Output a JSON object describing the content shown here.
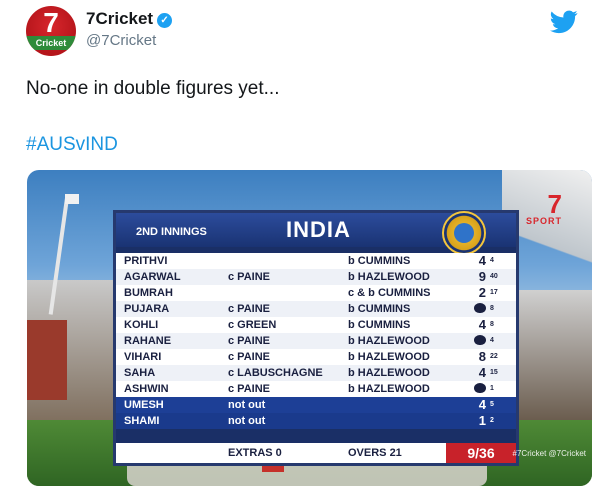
{
  "tweet": {
    "display_name": "7Cricket",
    "handle": "@7Cricket",
    "avatar_text": "7",
    "avatar_sub": "Cricket",
    "verified_icon": "verified-icon",
    "brand_icon": "twitter-bird-icon",
    "text": "No-one in double figures yet...",
    "hashtag": "#AUSvIND",
    "colors": {
      "link": "#1b95e0",
      "brand": "#1da1f2"
    }
  },
  "scorecard": {
    "innings": "2ND INNINGS",
    "team": "INDIA",
    "sport_logo": {
      "seven": "7",
      "word": "SPORT"
    },
    "batting": [
      {
        "name": "PRITHVI",
        "fielder": "",
        "bowler": "b CUMMINS",
        "runs": "4",
        "balls": "4",
        "duck": false
      },
      {
        "name": "AGARWAL",
        "fielder": "c PAINE",
        "bowler": "b HAZLEWOOD",
        "runs": "9",
        "balls": "40",
        "duck": false
      },
      {
        "name": "BUMRAH",
        "fielder": "",
        "bowler": "c & b CUMMINS",
        "runs": "2",
        "balls": "17",
        "duck": false
      },
      {
        "name": "PUJARA",
        "fielder": "c PAINE",
        "bowler": "b CUMMINS",
        "runs": "",
        "balls": "8",
        "duck": true
      },
      {
        "name": "KOHLI",
        "fielder": "c GREEN",
        "bowler": "b CUMMINS",
        "runs": "4",
        "balls": "8",
        "duck": false
      },
      {
        "name": "RAHANE",
        "fielder": "c PAINE",
        "bowler": "b HAZLEWOOD",
        "runs": "",
        "balls": "4",
        "duck": true
      },
      {
        "name": "VIHARI",
        "fielder": "c PAINE",
        "bowler": "b HAZLEWOOD",
        "runs": "8",
        "balls": "22",
        "duck": false
      },
      {
        "name": "SAHA",
        "fielder": "c LABUSCHAGNE",
        "bowler": "b HAZLEWOOD",
        "runs": "4",
        "balls": "15",
        "duck": false
      },
      {
        "name": "ASHWIN",
        "fielder": "c PAINE",
        "bowler": "b HAZLEWOOD",
        "runs": "",
        "balls": "1",
        "duck": true
      },
      {
        "name": "UMESH",
        "fielder": "not out",
        "bowler": "",
        "runs": "4",
        "balls": "5",
        "duck": false,
        "not_out": true
      },
      {
        "name": "SHAMI",
        "fielder": "not out",
        "bowler": "",
        "runs": "1",
        "balls": "2",
        "duck": false,
        "not_out": true
      }
    ],
    "extras": "EXTRAS 0",
    "overs": "OVERS 21",
    "total": "9/36",
    "credit": "#7Cricket @7Cricket",
    "colors": {
      "panel": "#1a2f66",
      "total_bg": "#c8222a",
      "not_out_row": "#1a3a8c"
    }
  }
}
